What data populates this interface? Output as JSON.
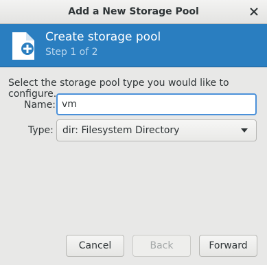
{
  "window": {
    "title": "Add a New Storage Pool"
  },
  "banner": {
    "title": "Create storage pool",
    "subtitle": "Step 1 of 2",
    "icon": "new-file-icon"
  },
  "form": {
    "instruction": "Select the storage pool type you would like to configure.",
    "name_label": "Name:",
    "name_value": "vm",
    "type_label": "Type:",
    "type_value": "dir: Filesystem Directory"
  },
  "buttons": {
    "cancel": "Cancel",
    "back": "Back",
    "forward": "Forward"
  },
  "colors": {
    "banner_bg": "#2a7ec0",
    "focus_border": "#4a90d9"
  }
}
